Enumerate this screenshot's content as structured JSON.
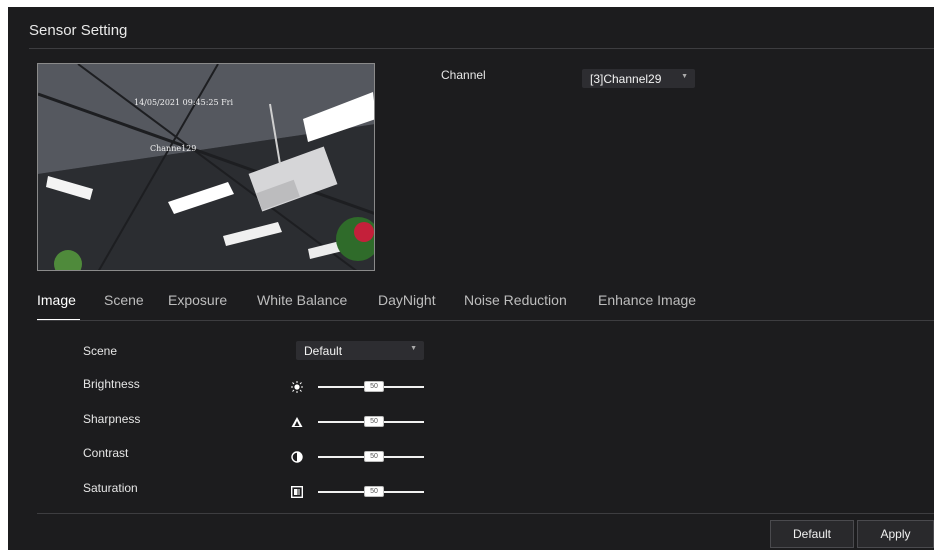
{
  "page": {
    "title": "Sensor Setting"
  },
  "preview": {
    "timestamp": "14/05/2021 09:45:25 Fri",
    "channel_osd": "Channe129"
  },
  "channel": {
    "label": "Channel",
    "value": "[3]Channel29"
  },
  "tabs": [
    {
      "label": "Image",
      "active": true
    },
    {
      "label": "Scene"
    },
    {
      "label": "Exposure"
    },
    {
      "label": "White Balance"
    },
    {
      "label": "DayNight"
    },
    {
      "label": "Noise Reduction"
    },
    {
      "label": "Enhance Image"
    }
  ],
  "image_settings": {
    "scene": {
      "label": "Scene",
      "value": "Default"
    },
    "sliders": [
      {
        "label": "Brightness",
        "value": "50",
        "icon": "sun-icon"
      },
      {
        "label": "Sharpness",
        "value": "50",
        "icon": "triangle-icon"
      },
      {
        "label": "Contrast",
        "value": "50",
        "icon": "contrast-icon"
      },
      {
        "label": "Saturation",
        "value": "50",
        "icon": "saturation-icon"
      }
    ]
  },
  "buttons": {
    "default": "Default",
    "apply": "Apply"
  }
}
